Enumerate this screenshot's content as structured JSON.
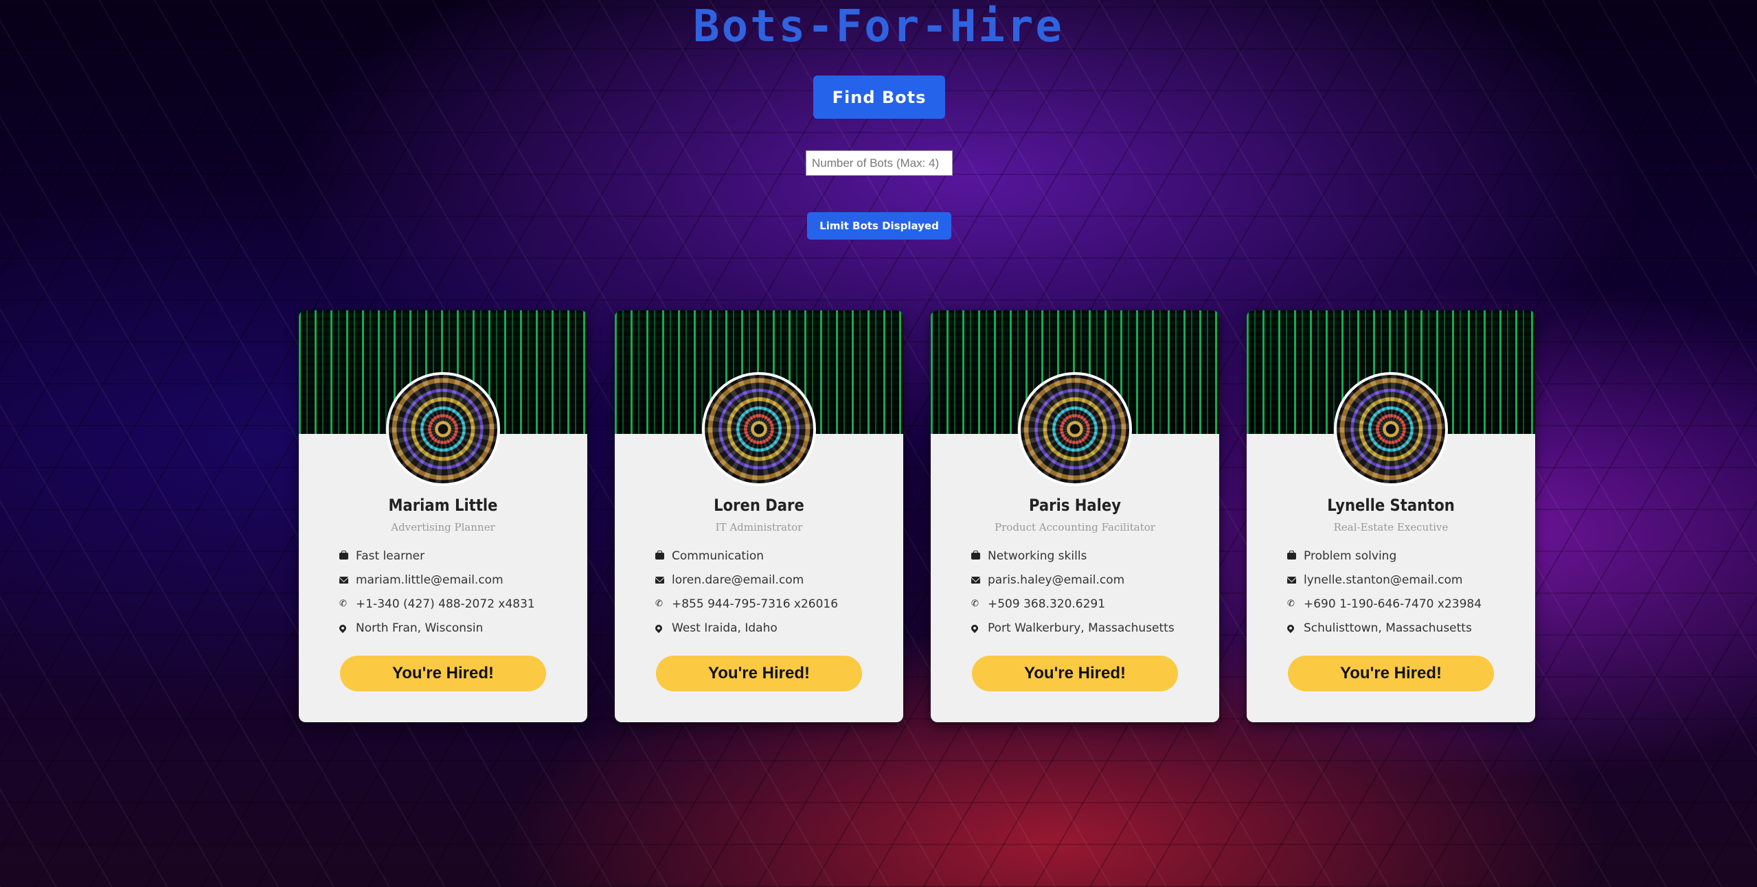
{
  "header": {
    "title": "Bots-For-Hire"
  },
  "controls": {
    "find_label": "Find Bots",
    "count_placeholder": "Number of Bots (Max: 4)",
    "limit_label": "Limit Bots Displayed"
  },
  "colors": {
    "accent": "#2563eb",
    "hire": "#fcc942",
    "card": "#f0f0f0"
  },
  "cards": [
    {
      "name": "Mariam Little",
      "role": "Advertising Planner",
      "skill": "Fast learner",
      "email": "mariam.little@email.com",
      "phone": "+1-340 (427) 488-2072 x4831",
      "location": "North Fran, Wisconsin",
      "button": "You're Hired!"
    },
    {
      "name": "Loren Dare",
      "role": "IT Administrator",
      "skill": "Communication",
      "email": "loren.dare@email.com",
      "phone": "+855 944-795-7316 x26016",
      "location": "West Iraida, Idaho",
      "button": "You're Hired!"
    },
    {
      "name": "Paris Haley",
      "role": "Product Accounting Facilitator",
      "skill": "Networking skills",
      "email": "paris.haley@email.com",
      "phone": "+509 368.320.6291",
      "location": "Port Walkerbury, Massachusetts",
      "button": "You're Hired!"
    },
    {
      "name": "Lynelle Stanton",
      "role": "Real-Estate Executive",
      "skill": "Problem solving",
      "email": "lynelle.stanton@email.com",
      "phone": "+690 1-190-646-7470 x23984",
      "location": "Schulisttown, Massachusetts",
      "button": "You're Hired!"
    }
  ]
}
